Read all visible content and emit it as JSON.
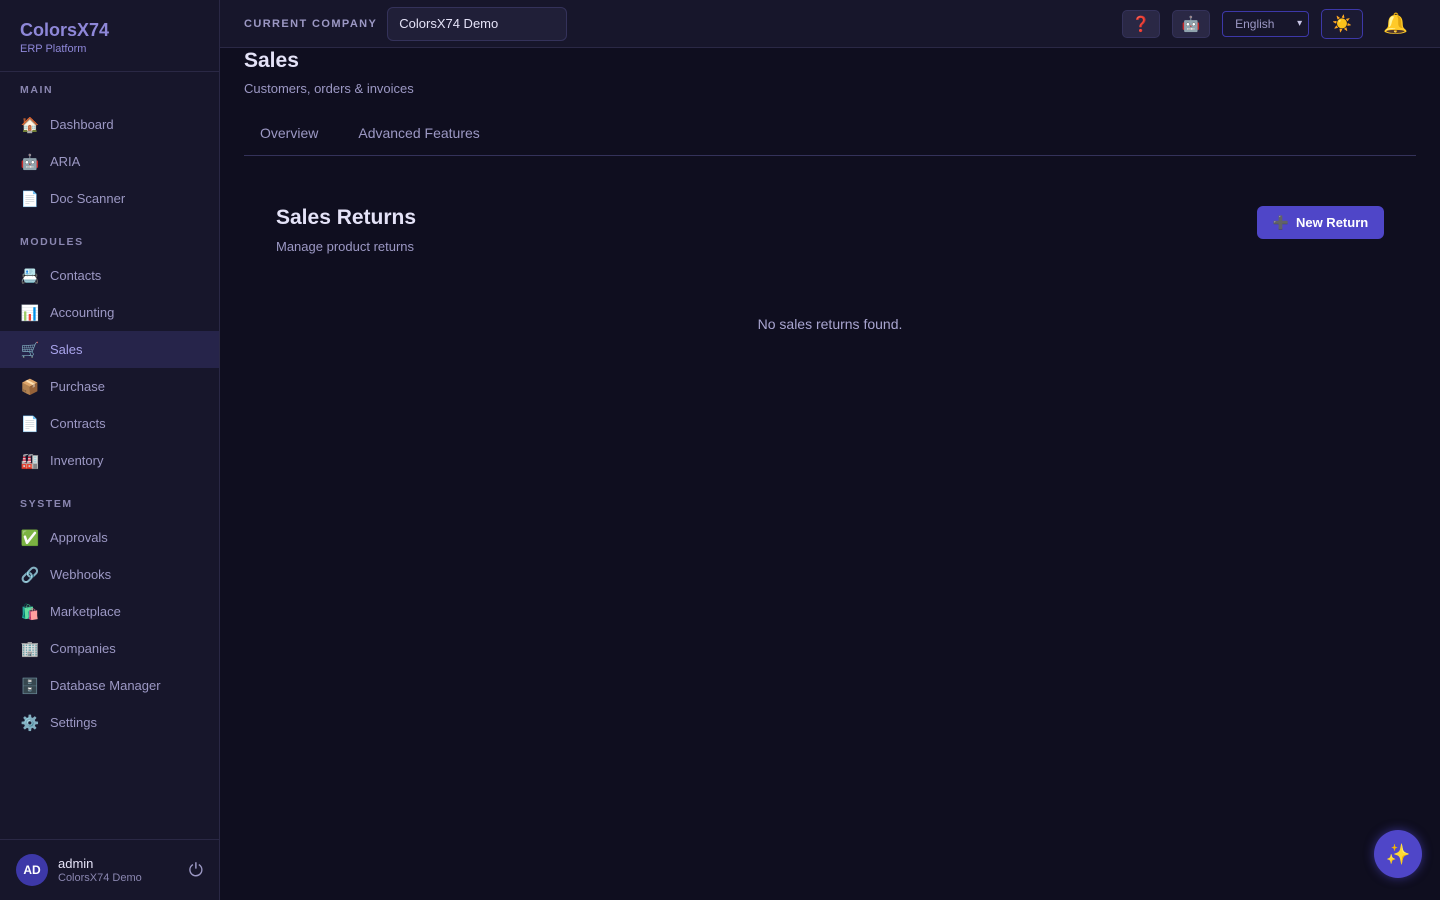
{
  "brand": {
    "title": "ColorsX74",
    "subtitle": "ERP Platform"
  },
  "sidebar": {
    "sections": [
      {
        "label": "MAIN",
        "items": [
          {
            "label": "Dashboard",
            "icon": "🏠"
          },
          {
            "label": "ARIA",
            "icon": "🤖"
          },
          {
            "label": "Doc Scanner",
            "icon": "📄"
          }
        ]
      },
      {
        "label": "MODULES",
        "items": [
          {
            "label": "Contacts",
            "icon": "📇"
          },
          {
            "label": "Accounting",
            "icon": "📊"
          },
          {
            "label": "Sales",
            "icon": "🛒",
            "active": true
          },
          {
            "label": "Purchase",
            "icon": "📦"
          },
          {
            "label": "Contracts",
            "icon": "📄"
          },
          {
            "label": "Inventory",
            "icon": "🏭"
          }
        ]
      },
      {
        "label": "SYSTEM",
        "items": [
          {
            "label": "Approvals",
            "icon": "✅"
          },
          {
            "label": "Webhooks",
            "icon": "🔗"
          },
          {
            "label": "Marketplace",
            "icon": "🛍️"
          },
          {
            "label": "Companies",
            "icon": "🏢"
          },
          {
            "label": "Database Manager",
            "icon": "🗄️"
          },
          {
            "label": "Settings",
            "icon": "⚙️"
          }
        ]
      }
    ]
  },
  "user": {
    "initials": "AD",
    "name": "admin",
    "company": "ColorsX74 Demo",
    "logout_icon": "⏻"
  },
  "topbar": {
    "company_label": "CURRENT COMPANY",
    "company_value": "ColorsX74 Demo",
    "help_icon": "❓",
    "bot_icon": "🤖",
    "language": "English",
    "theme_icon": "☀️",
    "bell_icon": "🔔"
  },
  "page": {
    "title": "Sales",
    "subtitle": "Customers, orders & invoices",
    "tabs": [
      {
        "label": "Overview"
      },
      {
        "label": "Advanced Features"
      }
    ]
  },
  "returns": {
    "title": "Sales Returns",
    "subtitle": "Manage product returns",
    "new_button_icon": "➕",
    "new_button_label": "New Return",
    "empty_text": "No sales returns found."
  },
  "fab_icon": "✨",
  "colors": {
    "accent": "#4f46c8",
    "background": "#0f0e1f",
    "sidebar": "#17162b"
  }
}
